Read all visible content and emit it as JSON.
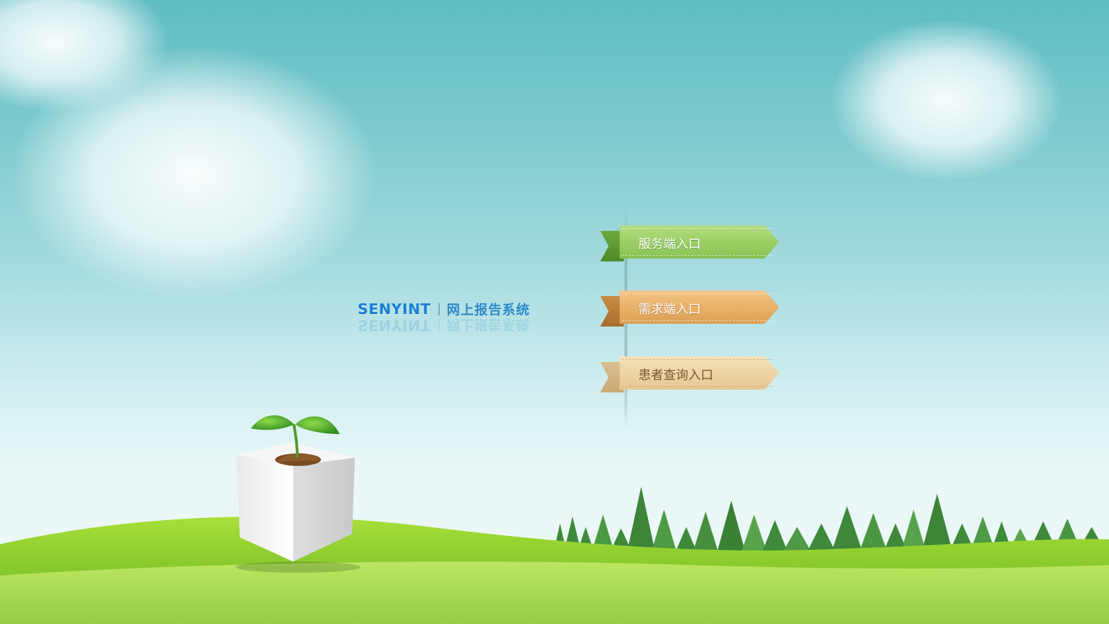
{
  "brand": {
    "name": "SENYINT",
    "subtitle": "网上报告系统"
  },
  "entries": [
    {
      "label": "服务端入口",
      "color": "#9ccf67"
    },
    {
      "label": "需求端入口",
      "color": "#e8b06a"
    },
    {
      "label": "患者查询入口",
      "color": "#eed4a6"
    }
  ],
  "scene": {
    "sky_top": "#5fbdc3",
    "grass": "#8fce2f",
    "decorations": [
      "cloud",
      "seedling-in-cube",
      "tree-line",
      "grass-field"
    ]
  }
}
